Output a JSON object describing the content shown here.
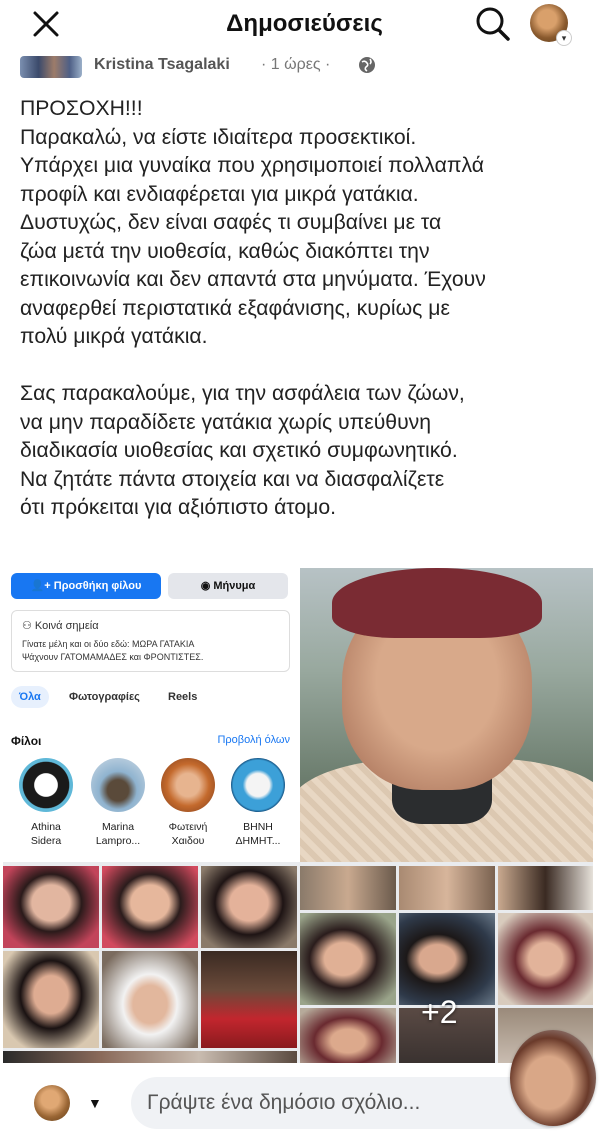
{
  "topbar": {
    "title": "Δημοσιεύσεις"
  },
  "post": {
    "author": "Kristina Tsagalaki",
    "meta": "· 1 ώρες ·",
    "lines_p1": [
      "ΠΡΟΣΟΧΗ!!!",
      "Παρακαλώ, να είστε ιδιαίτερα προσεκτικοί.",
      "Υπάρχει μια γυναίκα που χρησιμοποιεί πολλαπλά",
      "προφίλ και ενδιαφέρεται για μικρά γατάκια.",
      "Δυστυχώς, δεν είναι σαφές τι συμβαίνει με τα",
      "ζώα μετά την υιοθεσία, καθώς διακόπτει την",
      "επικοινωνία και δεν απαντά στα μηνύματα. Έχουν",
      "αναφερθεί περιστατικά εξαφάνισης, κυρίως με",
      "πολύ μικρά γατάκια."
    ],
    "lines_p2": [
      "Σας παρακαλούμε, για την ασφάλεια των ζώων,",
      "να μην παραδίδετε γατάκια χωρίς υπεύθυνη",
      "διαδικασία υιοθεσίας και σχετικό συμφωνητικό.",
      "Να ζητάτε πάντα στοιχεία και να διασφαλίζετε",
      "ότι πρόκειται για αξιόπιστο άτομο."
    ]
  },
  "embed": {
    "add_friend": "Προσθήκη φίλου",
    "message": "Μήνυμα",
    "mutual_title": "Κοινά σημεία",
    "mutual_line1": "Γίνατε μέλη και οι δύο εδώ: ΜΩΡΑ ΓΑΤΑΚΙΑ",
    "mutual_line2": "Ψάχνουν ΓΑΤΟΜΑΜΑΔΕΣ και ΦΡΟΝΤΙΣΤΕΣ.",
    "tabs": [
      "Όλα",
      "Φωτογραφίες",
      "Reels"
    ],
    "friends_heading": "Φίλοι",
    "see_all": "Προβολή όλων",
    "friends": [
      {
        "line1": "Athina",
        "line2": "Sidera"
      },
      {
        "line1": "Marina",
        "line2": "Lampro..."
      },
      {
        "line1": "Φωτεινή",
        "line2": "Χαιδου"
      },
      {
        "line1": "ΒΗΝΗ",
        "line2": "ΔΗΜΗΤ..."
      }
    ],
    "more_count": "+2"
  },
  "comment": {
    "placeholder": "Γράψτε ένα δημόσιο σχόλιο..."
  },
  "colors": {
    "accent": "#1877f2",
    "input_bg": "#f0f2f5"
  },
  "icons": [
    "close-icon",
    "search-icon",
    "globe-icon",
    "caret-down-icon",
    "messenger-icon",
    "add-person-icon",
    "people-icon"
  ]
}
